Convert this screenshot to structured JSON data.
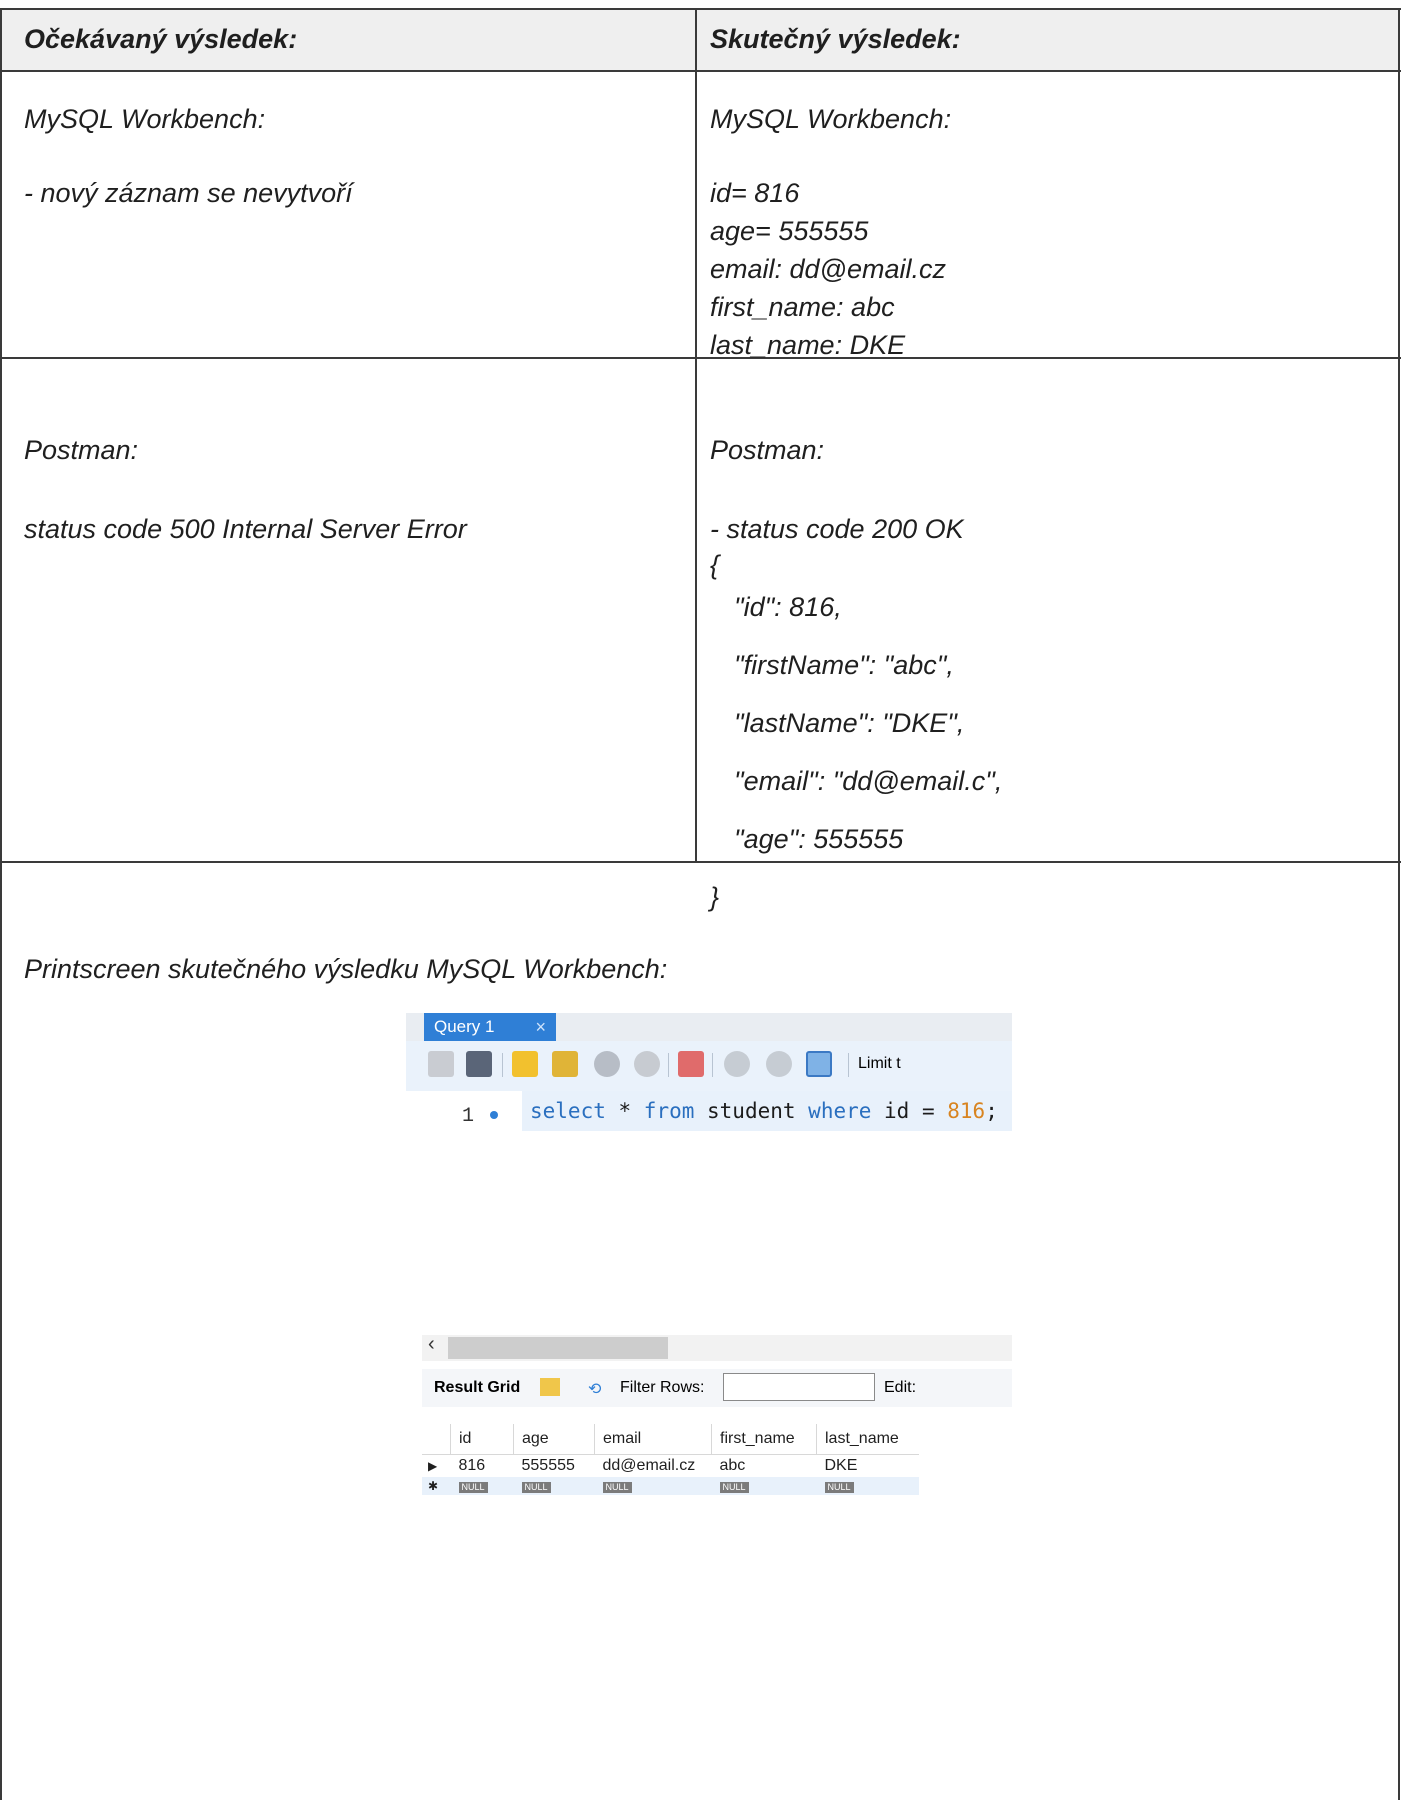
{
  "table": {
    "header_left": "Očekávaný výsledek:",
    "header_right": "Skutečný výsledek:",
    "row1": {
      "left_title": "MySQL Workbench:",
      "left_text": "- nový záznam se nevytvoří",
      "right_title": "MySQL Workbench:",
      "right_lines": [
        "id= 816",
        "age= 555555",
        "email: dd@email.cz",
        "first_name: abc",
        "last_name: DKE"
      ]
    },
    "row2": {
      "left_title": "Postman:",
      "left_text": "status code 500 Internal Server Error",
      "right_title": "Postman:",
      "right_status": "- status code 200 OK",
      "json_open": "{",
      "json_lines": [
        "\"id\": 816,",
        "\"firstName\": \"abc\",",
        "\"lastName\": \"DKE\",",
        "\"email\": \"dd@email.c\",",
        "\"age\": 555555"
      ],
      "json_close": "}"
    },
    "row3": {
      "title": "Printscreen skutečného výsledku MySQL Workbench:"
    }
  },
  "workbench": {
    "tab_label": "Query 1",
    "tab_close": "×",
    "limit_label": "Limit t",
    "line_number": "1",
    "sql_tokens": [
      {
        "t": "select",
        "c": "kw"
      },
      {
        "t": " * ",
        "c": "plain"
      },
      {
        "t": "from",
        "c": "kw"
      },
      {
        "t": " student ",
        "c": "plain"
      },
      {
        "t": "where",
        "c": "kw"
      },
      {
        "t": " id = ",
        "c": "plain"
      },
      {
        "t": "816",
        "c": "num"
      },
      {
        "t": ";",
        "c": "plain"
      }
    ],
    "result_grid_label": "Result Grid",
    "filter_rows_label": "Filter Rows:",
    "edit_label": "Edit:",
    "columns": [
      "id",
      "age",
      "email",
      "first_name",
      "last_name"
    ],
    "row": [
      "816",
      "555555",
      "dd@email.cz",
      "abc",
      "DKE"
    ],
    "null_label": "NULL",
    "colors": {
      "tab": "#2f7fd6",
      "keyword": "#2a6fbf",
      "number": "#d88420"
    }
  }
}
